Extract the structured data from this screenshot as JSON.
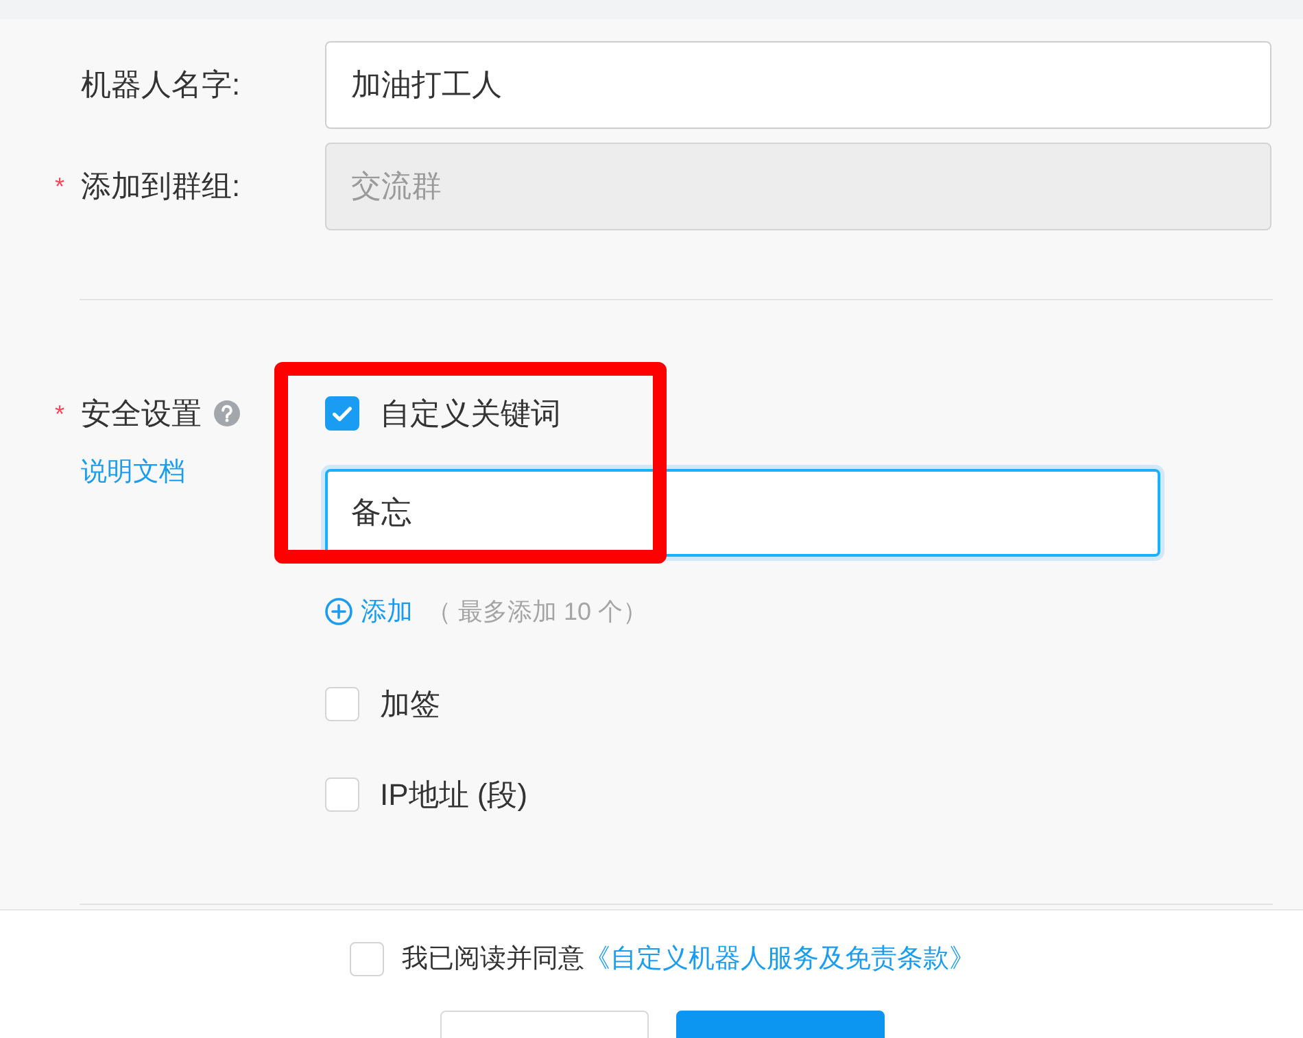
{
  "form": {
    "fields": [
      {
        "label": "机器人名字:",
        "value": "加油打工人",
        "disabled": false
      },
      {
        "required_mark": "*",
        "label": "添加到群组:",
        "value": "交流群",
        "disabled": true
      }
    ]
  },
  "security": {
    "required_mark": "*",
    "label": "安全设置",
    "doc_link": "说明文档",
    "options": [
      {
        "label": "自定义关键词",
        "checked": true,
        "keywords": [
          {
            "value": "备忘",
            "focused": true
          }
        ],
        "add_link": "添加",
        "add_hint": "（ 最多添加 10 个）"
      },
      {
        "label": "加签",
        "checked": false
      },
      {
        "label": "IP地址 (段)",
        "checked": false
      }
    ]
  },
  "agreement": {
    "checked": false,
    "text": "我已阅读并同意",
    "link": "《自定义机器人服务及免责条款》"
  },
  "buttons": [
    {
      "kind": "secondary"
    },
    {
      "kind": "primary"
    }
  ]
}
